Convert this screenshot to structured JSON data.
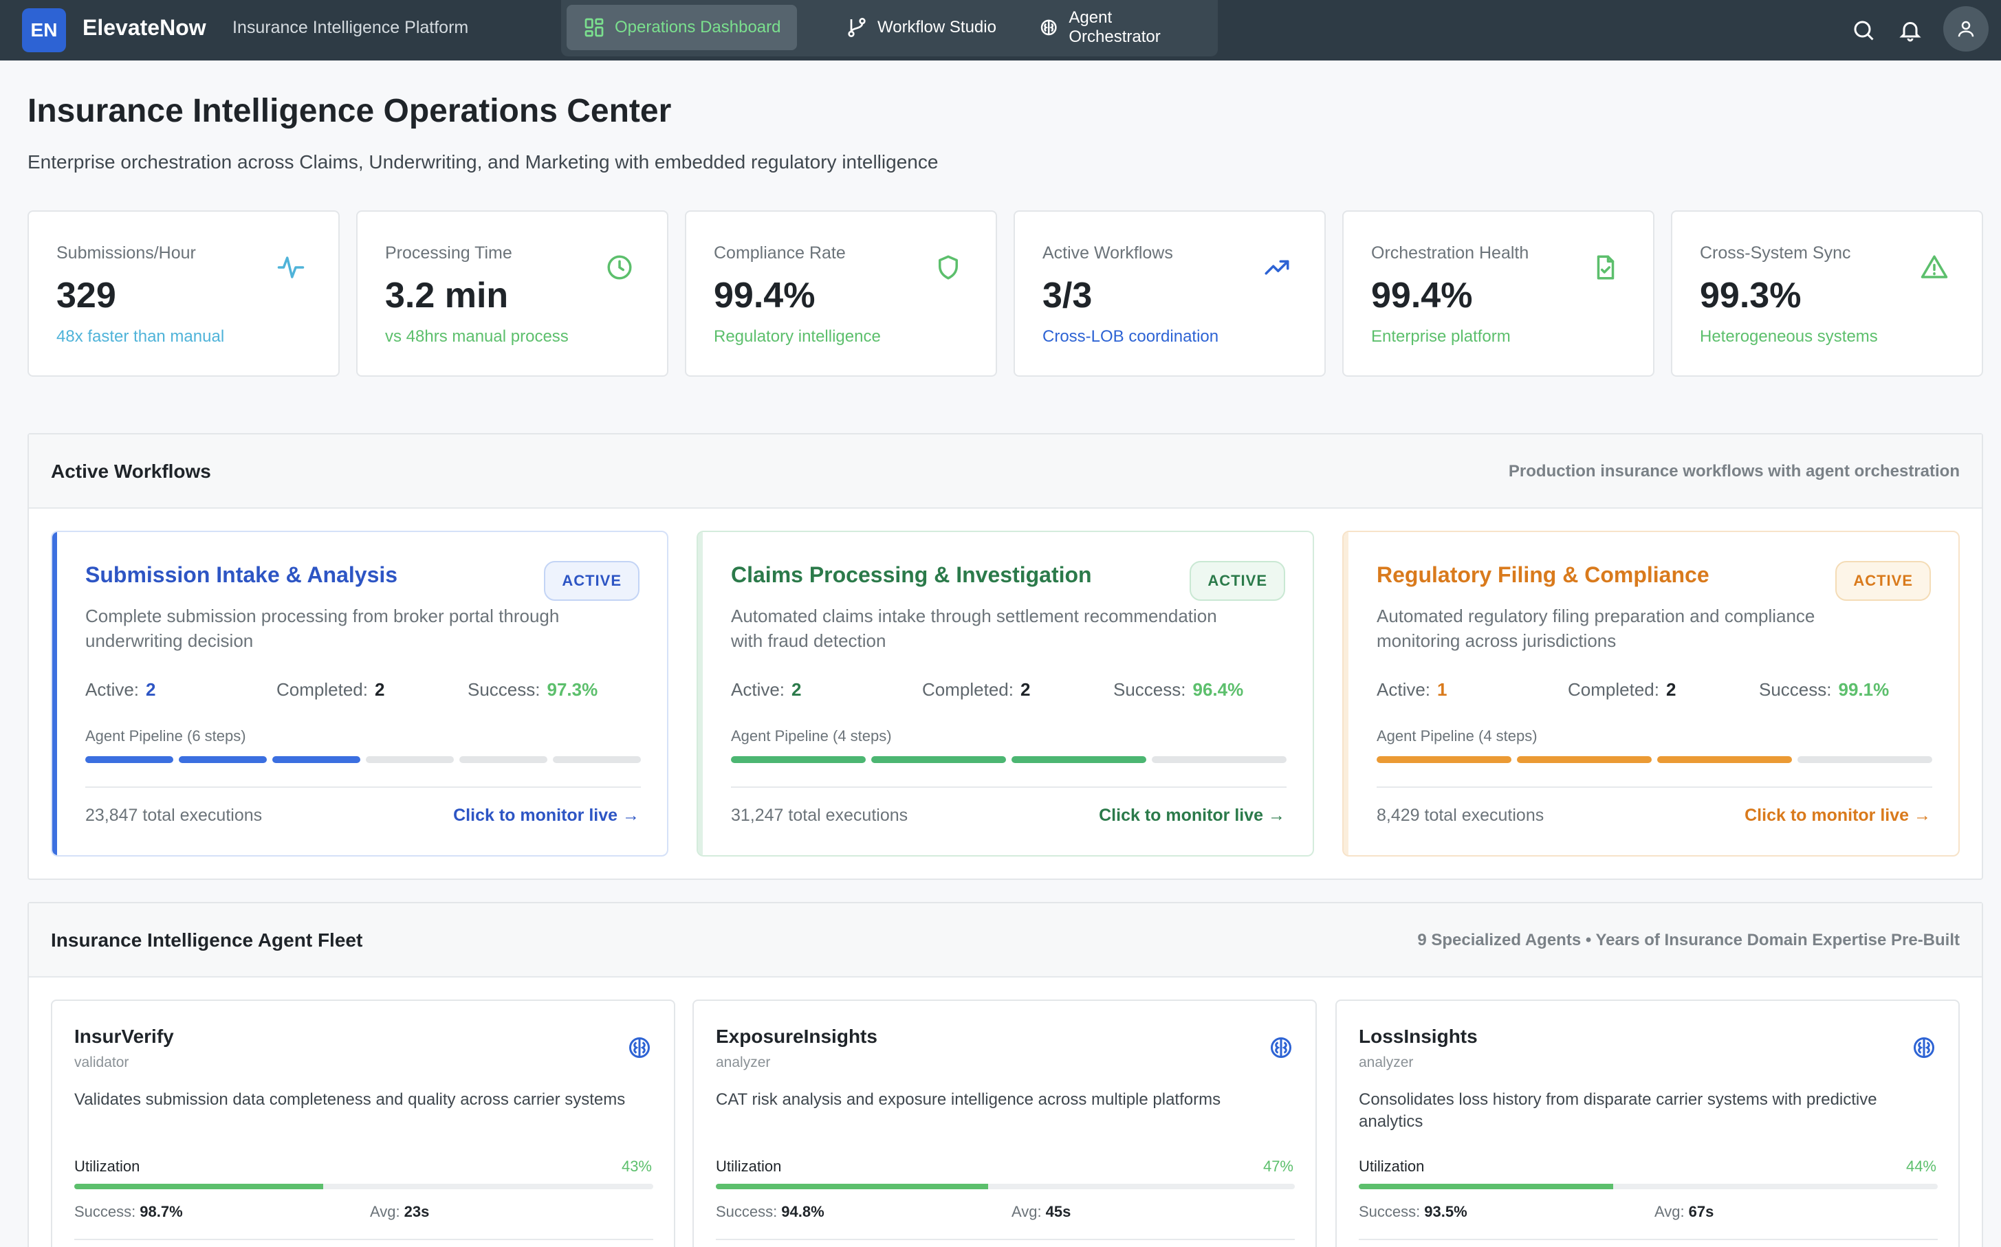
{
  "app": {
    "logo": "EN",
    "brand": "ElevateNow",
    "subtitle": "Insurance Intelligence Platform"
  },
  "nav": {
    "tabs": [
      {
        "label": "Operations Dashboard",
        "active": true,
        "icon": "grid-icon"
      },
      {
        "label": "Workflow Studio",
        "active": false,
        "icon": "branch-icon"
      },
      {
        "label": "Agent Orchestrator",
        "active": false,
        "icon": "brain-icon"
      }
    ]
  },
  "header": {
    "title": "Insurance Intelligence Operations Center",
    "subtitle": "Enterprise orchestration across Claims, Underwriting, and Marketing with embedded regulatory intelligence"
  },
  "kpis": [
    {
      "label": "Submissions/Hour",
      "value": "329",
      "note": "48x faster than manual",
      "note_color": "#4fb3d9",
      "icon": "activity-icon",
      "icon_color": "#4fb3d9"
    },
    {
      "label": "Processing Time",
      "value": "3.2 min",
      "note": "vs 48hrs manual process",
      "note_color": "#5cbf6c",
      "icon": "clock-icon",
      "icon_color": "#5cbf6c"
    },
    {
      "label": "Compliance Rate",
      "value": "99.4%",
      "note": "Regulatory intelligence",
      "note_color": "#5cbf6c",
      "icon": "shield-icon",
      "icon_color": "#5cbf6c"
    },
    {
      "label": "Active Workflows",
      "value": "3/3",
      "note": "Cross-LOB coordination",
      "note_color": "#2d63d4",
      "icon": "trending-up-icon",
      "icon_color": "#2d63d4"
    },
    {
      "label": "Orchestration Health",
      "value": "99.4%",
      "note": "Enterprise platform",
      "note_color": "#5cbf6c",
      "icon": "file-check-icon",
      "icon_color": "#5cbf6c"
    },
    {
      "label": "Cross-System Sync",
      "value": "99.3%",
      "note": "Heterogeneous systems",
      "note_color": "#5cbf6c",
      "icon": "alert-triangle-icon",
      "icon_color": "#5cbf6c"
    }
  ],
  "workflows_section": {
    "title": "Active Workflows",
    "description": "Production insurance workflows with agent orchestration",
    "labels": {
      "active": "Active:",
      "completed": "Completed:",
      "success": "Success:"
    },
    "items": [
      {
        "title": "Submission Intake & Analysis",
        "badge": "ACTIVE",
        "description": "Complete submission processing from broker portal through underwriting decision",
        "active": "2",
        "completed": "2",
        "success": "97.3%",
        "pipeline_label": "Agent Pipeline (6 steps)",
        "steps_total": 6,
        "steps_done": 3,
        "total_executions": "23,847 total executions",
        "link": "Click to monitor live →",
        "accent": "#3b6fe0"
      },
      {
        "title": "Claims Processing & Investigation",
        "badge": "ACTIVE",
        "description": "Automated claims intake through settlement recommendation with fraud detection",
        "active": "2",
        "completed": "2",
        "success": "96.4%",
        "pipeline_label": "Agent Pipeline (4 steps)",
        "steps_total": 4,
        "steps_done": 3,
        "total_executions": "31,247 total executions",
        "link": "Click to monitor live →",
        "accent": "#4cb672"
      },
      {
        "title": "Regulatory Filing & Compliance",
        "badge": "ACTIVE",
        "description": "Automated regulatory filing preparation and compliance monitoring across jurisdictions",
        "active": "1",
        "completed": "2",
        "success": "99.1%",
        "pipeline_label": "Agent Pipeline (4 steps)",
        "steps_total": 4,
        "steps_done": 3,
        "total_executions": "8,429 total executions",
        "link": "Click to monitor live →",
        "accent": "#eb9a34"
      }
    ]
  },
  "agents_section": {
    "title": "Insurance Intelligence Agent Fleet",
    "description": "9 Specialized Agents • Years of Insurance Domain Expertise Pre-Built",
    "labels": {
      "utilization": "Utilization",
      "success": "Success:",
      "avg": "Avg:"
    },
    "items": [
      {
        "name": "InsurVerify",
        "role": "validator",
        "description": "Validates submission data completeness and quality across carrier systems",
        "utilization": "43%",
        "utilization_value": 0.43,
        "success": "98.7%",
        "avg": "23s"
      },
      {
        "name": "ExposureInsights",
        "role": "analyzer",
        "description": "CAT risk analysis and exposure intelligence across multiple platforms",
        "utilization": "47%",
        "utilization_value": 0.47,
        "success": "94.8%",
        "avg": "45s"
      },
      {
        "name": "LossInsights",
        "role": "analyzer",
        "description": "Consolidates loss history from disparate carrier systems with predictive analytics",
        "utilization": "44%",
        "utilization_value": 0.44,
        "success": "93.5%",
        "avg": "67s"
      }
    ]
  }
}
